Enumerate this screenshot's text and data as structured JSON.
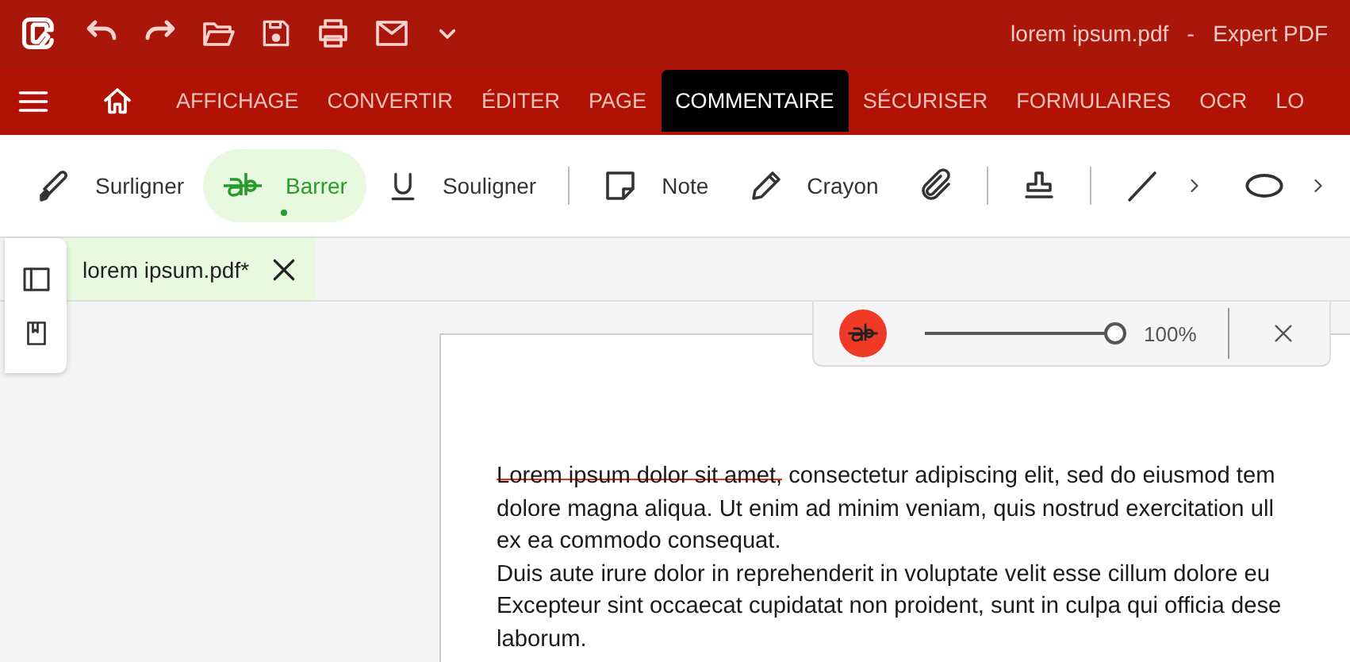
{
  "window": {
    "title": "lorem ipsum.pdf   -   Expert PDF"
  },
  "ribbon_tabs": [
    {
      "kind": "home",
      "selected": false
    },
    {
      "kind": "text",
      "label": "AFFICHAGE",
      "selected": false
    },
    {
      "kind": "text",
      "label": "CONVERTIR",
      "selected": false
    },
    {
      "kind": "text",
      "label": "ÉDITER",
      "selected": false
    },
    {
      "kind": "text",
      "label": "PAGE",
      "selected": false
    },
    {
      "kind": "text",
      "label": "COMMENTAIRE",
      "selected": true
    },
    {
      "kind": "text",
      "label": "SÉCURISER",
      "selected": false
    },
    {
      "kind": "text",
      "label": "FORMULAIRES",
      "selected": false
    },
    {
      "kind": "text",
      "label": "OCR",
      "selected": false
    },
    {
      "kind": "text",
      "label": "LO",
      "selected": false
    }
  ],
  "toolbar": [
    {
      "kind": "tool",
      "label": "Surligner",
      "selected": false
    },
    {
      "kind": "tool",
      "label": "Barrer",
      "selected": true
    },
    {
      "kind": "tool",
      "label": "Souligner",
      "selected": false
    },
    {
      "kind": "separator"
    },
    {
      "kind": "tool",
      "label": "Note",
      "selected": false
    },
    {
      "kind": "tool",
      "label": "Crayon",
      "selected": false
    },
    {
      "kind": "icon",
      "selected": false
    },
    {
      "kind": "separator"
    },
    {
      "kind": "icon",
      "selected": false
    },
    {
      "kind": "separator"
    },
    {
      "kind": "dropdown",
      "selected": false
    },
    {
      "kind": "dropdown",
      "selected": false
    }
  ],
  "document_tabs": [
    {
      "label": "lorem ipsum.pdf*",
      "selected": true
    }
  ],
  "strike_popup": {
    "color": "#f03a25",
    "level": 1.0,
    "reading": "100%"
  },
  "page": {
    "lines": [
      [
        {
          "text": "Lorem ipsum dolor sit amet,",
          "struck": true
        },
        {
          "text": " consectetur adipiscing elit, sed do eiusmod tem",
          "struck": false
        }
      ],
      [
        {
          "text": "dolore magna aliqua. Ut enim ad minim veniam, quis nostrud exercitation ull",
          "struck": false
        }
      ],
      [
        {
          "text": "ex ea commodo consequat.",
          "struck": false
        }
      ],
      [
        {
          "text": "Duis aute irure dolor in reprehenderit in voluptate velit esse cillum dolore eu",
          "struck": false
        }
      ],
      [
        {
          "text": "Excepteur sint occaecat cupidatat non proident, sunt in culpa qui officia dese",
          "struck": false
        }
      ],
      [
        {
          "text": "laborum.",
          "struck": false
        }
      ]
    ]
  }
}
